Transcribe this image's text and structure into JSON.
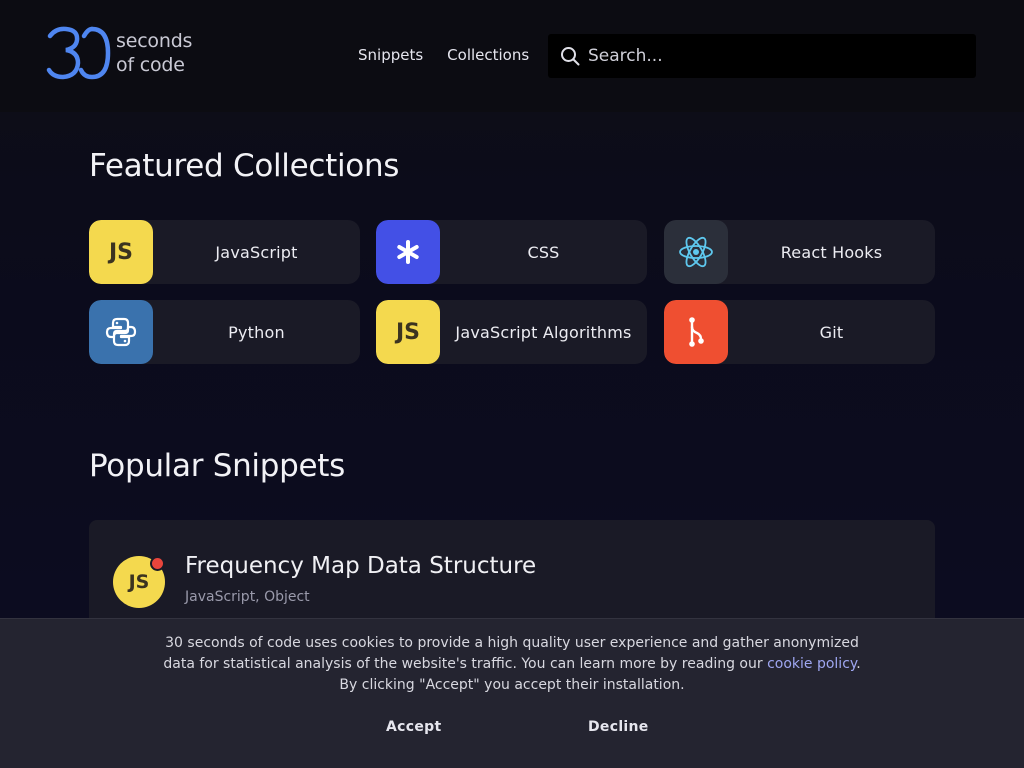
{
  "logo": {
    "mark": "30",
    "line1": "seconds",
    "line2": "of code"
  },
  "nav": {
    "snippets": "Snippets",
    "collections": "Collections"
  },
  "search": {
    "placeholder": "Search..."
  },
  "featured": {
    "title": "Featured Collections",
    "items": [
      {
        "label": "JavaScript",
        "icon": "js-icon",
        "icon_text": "JS",
        "color": "#f4d94e"
      },
      {
        "label": "CSS",
        "icon": "asterisk-icon",
        "color": "#4350e6"
      },
      {
        "label": "React Hooks",
        "icon": "react-icon",
        "color": "#2b2f3a"
      },
      {
        "label": "Python",
        "icon": "python-icon",
        "color": "#3a72ad"
      },
      {
        "label": "JavaScript Algorithms",
        "icon": "js-icon",
        "icon_text": "JS",
        "color": "#f4d94e"
      },
      {
        "label": "Git",
        "icon": "git-branch-icon",
        "color": "#ef4f31"
      }
    ]
  },
  "popular": {
    "title": "Popular Snippets",
    "snippets": [
      {
        "title": "Frequency Map Data Structure",
        "tags": "JavaScript, Object",
        "icon_text": "JS",
        "is_new": true
      }
    ]
  },
  "cookie": {
    "text_before": "30 seconds of code uses cookies to provide a high quality user experience and gather anonymized data for statistical analysis of the website's traffic. You can learn more by reading our ",
    "link": "cookie policy",
    "text_after": ". By clicking \"Accept\" you accept their installation.",
    "accept": "Accept",
    "decline": "Decline"
  },
  "colors": {
    "accent": "#5b8def",
    "background": "#0b0b1c",
    "card": "#1a1a26"
  }
}
